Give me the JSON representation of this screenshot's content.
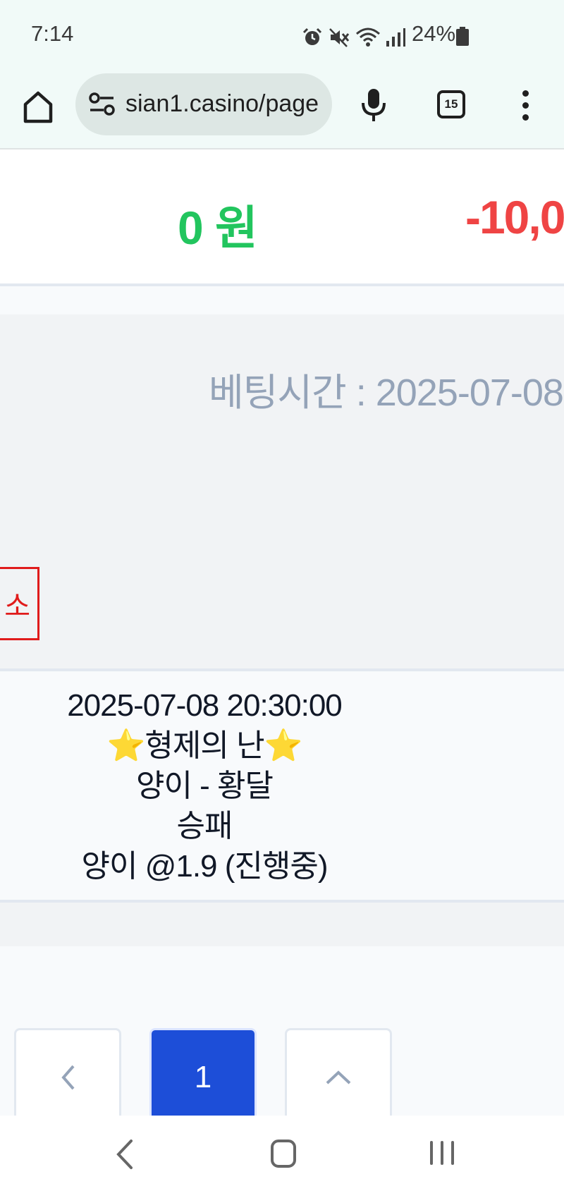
{
  "status_bar": {
    "time": "7:14",
    "battery": "24%",
    "icons": [
      "alarm-icon",
      "mute-icon",
      "wifi-icon",
      "signal-icon",
      "battery-icon"
    ]
  },
  "browser": {
    "url": "sian1.casino/page",
    "tab_count": "15",
    "icons": [
      "home-icon",
      "site-settings-icon",
      "mic-icon",
      "tabs-icon",
      "menu-icon"
    ]
  },
  "summary": {
    "win_amount": "0 원",
    "loss_amount": "-10,0",
    "colors": {
      "win": "#22c55e",
      "loss": "#ef4444"
    }
  },
  "bet": {
    "bet_time": "베팅시간 : 2025-07-08",
    "cancel_label": "소",
    "match_time": "2025-07-08 20:30:00",
    "league": "⭐형제의 난⭐",
    "teams": "양이 - 황달",
    "market": "승패",
    "pick": "양이 @1.9 (진행중)"
  },
  "pagination": {
    "prev_label": "<",
    "current_page": "1",
    "top_label": "^",
    "accent": "#1d4ed8"
  },
  "nav_bar": {
    "icons": [
      "back-icon",
      "home-icon",
      "recents-icon"
    ]
  }
}
